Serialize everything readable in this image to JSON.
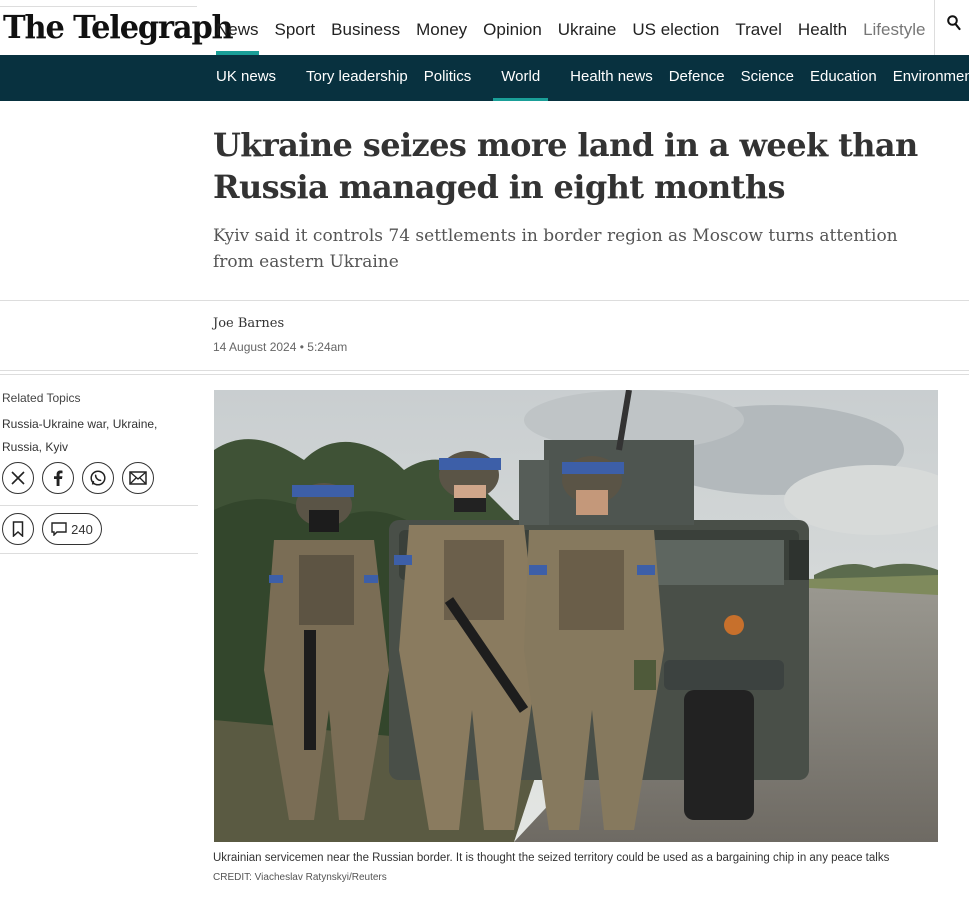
{
  "brand": {
    "logo_text": "The Telegraph"
  },
  "top_nav": [
    {
      "label": "News",
      "active": true
    },
    {
      "label": "Sport"
    },
    {
      "label": "Business"
    },
    {
      "label": "Money"
    },
    {
      "label": "Opinion"
    },
    {
      "label": "Ukraine"
    },
    {
      "label": "US election"
    },
    {
      "label": "Travel"
    },
    {
      "label": "Health"
    },
    {
      "label": "Lifestyle"
    }
  ],
  "search": {
    "icon": "search-icon"
  },
  "section_nav": [
    {
      "label": "UK news"
    },
    {
      "label": "Tory leadership"
    },
    {
      "label": "Politics"
    },
    {
      "label": "World",
      "active": true
    },
    {
      "label": "Health news"
    },
    {
      "label": "Defence"
    },
    {
      "label": "Science"
    },
    {
      "label": "Education"
    },
    {
      "label": "Environment"
    }
  ],
  "article": {
    "headline": "Ukraine seizes more land in a week than Russia managed in eight months",
    "standfirst": "Kyiv said it controls 74 settlements in border region as Moscow turns attention from eastern Ukraine",
    "author": "Joe Barnes",
    "date": "14 August 2024 • 5:24am",
    "caption": "Ukrainian servicemen near the Russian border. It is thought the seized territory could be used as a bargaining chip in any peace talks",
    "credit": "CREDIT: Viacheslav Ratynskyi/Reuters"
  },
  "sidebar": {
    "related_label": "Related Topics",
    "related_topics": "Russia-Ukraine war, Ukraine, Russia, Kyiv",
    "share_icons": [
      "x-icon",
      "facebook-icon",
      "whatsapp-icon",
      "email-icon"
    ],
    "comment_count": "240"
  },
  "colors": {
    "accent": "#1a9f98",
    "subnav_bg": "#08313f"
  }
}
